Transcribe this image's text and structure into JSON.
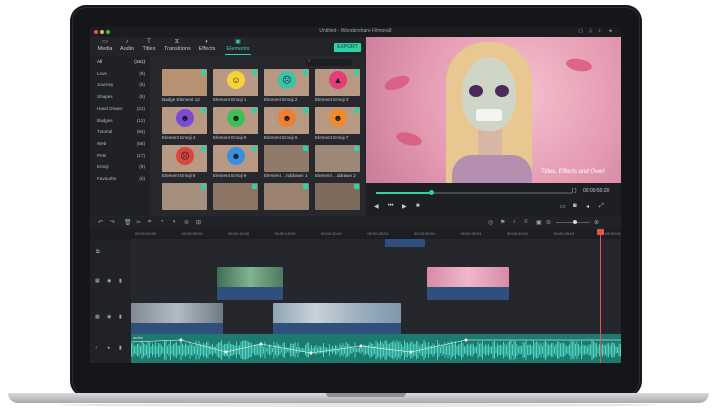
{
  "window": {
    "title": "Untitled - Wondershare Filmora9"
  },
  "toolbar": {
    "tabs": [
      {
        "label": "Media",
        "icon": "folder-icon"
      },
      {
        "label": "Audio",
        "icon": "music-note-icon"
      },
      {
        "label": "Titles",
        "icon": "text-t-icon"
      },
      {
        "label": "Transitions",
        "icon": "transition-icon"
      },
      {
        "label": "Effects",
        "icon": "effects-icon"
      },
      {
        "label": "Elements",
        "icon": "elements-icon"
      }
    ],
    "active_tab": "Elements",
    "export_label": "EXPORT"
  },
  "sidebar": {
    "categories": [
      {
        "label": "All",
        "count": "(161)"
      },
      {
        "label": "Love",
        "count": "(9)"
      },
      {
        "label": "Journey",
        "count": "(6)"
      },
      {
        "label": "Shapes",
        "count": "(6)"
      },
      {
        "label": "Hand Drawn",
        "count": "(21)"
      },
      {
        "label": "Badges",
        "count": "(12)"
      },
      {
        "label": "Tutorial",
        "count": "(64)"
      },
      {
        "label": "Web",
        "count": "(56)"
      },
      {
        "label": "Pets",
        "count": "(17)"
      },
      {
        "label": "Emoji",
        "count": "(9)"
      },
      {
        "label": "Favourite",
        "count": "(0)"
      }
    ]
  },
  "elements": [
    {
      "label": "Badge Element 12",
      "emoji": "",
      "color": "#b69273"
    },
    {
      "label": "Element Emoji 1",
      "emoji": "☺",
      "color": "#f5d33b"
    },
    {
      "label": "Element Emoji 2",
      "emoji": "☹",
      "color": "#37c4a8"
    },
    {
      "label": "Element Emoji 3",
      "emoji": "▲",
      "color": "#e53d7b"
    },
    {
      "label": "Element Emoji 4",
      "emoji": "☻",
      "color": "#7b4bd6"
    },
    {
      "label": "Element Emoji 5",
      "emoji": "☻",
      "color": "#3fbf57"
    },
    {
      "label": "Element Emoji 6",
      "emoji": "☻",
      "color": "#ef7f30"
    },
    {
      "label": "Element Emoji 7",
      "emoji": "☻",
      "color": "#f08a2a"
    },
    {
      "label": "Element Emoji 8",
      "emoji": "☹",
      "color": "#d8473e"
    },
    {
      "label": "Element Emoji 9",
      "emoji": "☻",
      "color": "#3b8fe0"
    },
    {
      "label": "Element ...nddrawn 1",
      "emoji": "",
      "color": "#8f7a6c"
    },
    {
      "label": "Element ...ddrawn 2",
      "emoji": "",
      "color": "#9d8777"
    },
    {
      "label": "",
      "emoji": "",
      "color": "#a58f7e"
    },
    {
      "label": "",
      "emoji": "",
      "color": "#8b7565"
    },
    {
      "label": "",
      "emoji": "",
      "color": "#9a8170"
    },
    {
      "label": "",
      "emoji": "",
      "color": "#7f6b5e"
    }
  ],
  "preview": {
    "title_overlay": "Titles, Effects and Overl",
    "timecode": "00:00:50:20",
    "progress": 0.28
  },
  "ruler": {
    "labels": [
      "00:00:00:00",
      "00:00:05:00",
      "00:00:10:00",
      "00:00:15:00",
      "00:00:20:01",
      "00:00:25:01",
      "00:00:30:01",
      "00:00:35:01",
      "00:00:40:01",
      "00:00:45:01",
      "00:00:50:01"
    ]
  },
  "timeline": {
    "zoom": 0.55,
    "audio_label": "audio"
  }
}
